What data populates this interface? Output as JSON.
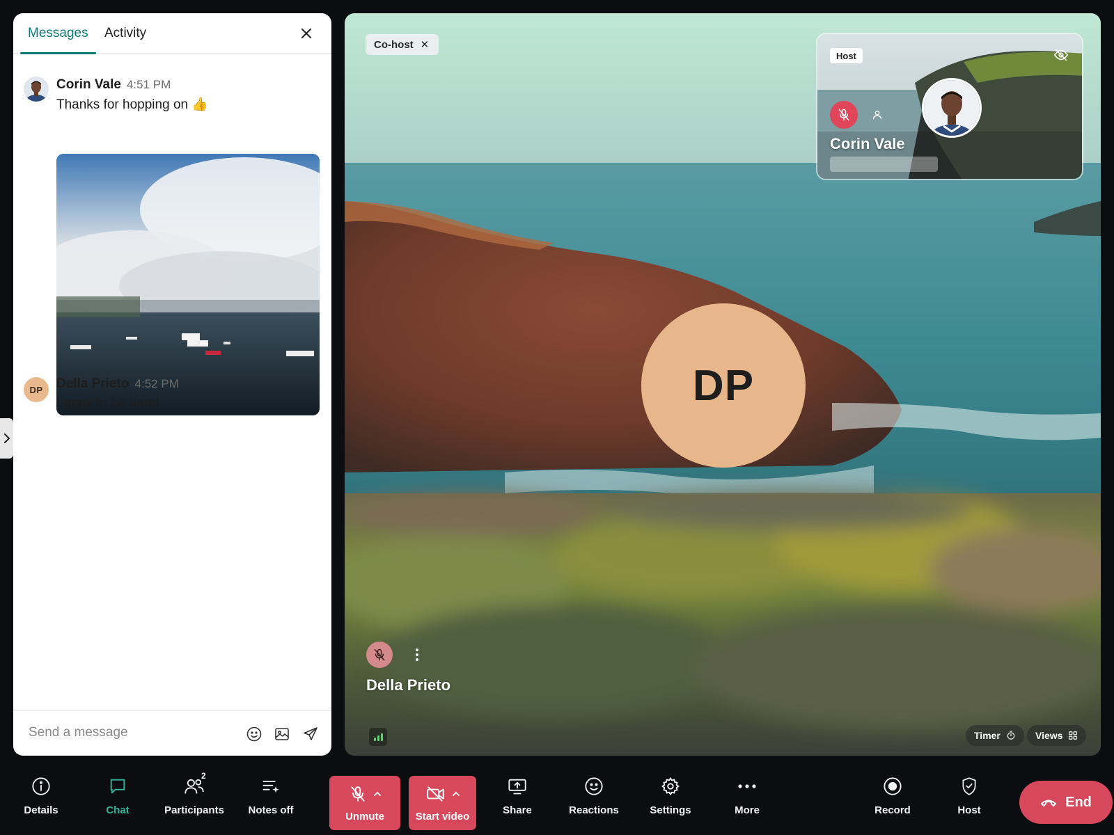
{
  "chat": {
    "tabs": [
      "Messages",
      "Activity"
    ],
    "messages": [
      {
        "name": "Corin Vale",
        "time": "4:51 PM",
        "text": "Thanks for hopping on 👍"
      },
      {
        "name": "Della Prieto",
        "initials": "DP",
        "time": "4:52 PM",
        "text": "happy to be here!"
      }
    ],
    "composer_placeholder": "Send a message"
  },
  "stage": {
    "cohost_label": "Co-host",
    "main_initials": "DP",
    "main_name": "Della Prieto",
    "timer_label": "Timer",
    "views_label": "Views",
    "host_tile": {
      "badge": "Host",
      "name": "Corin Vale"
    }
  },
  "toolbar": {
    "details": "Details",
    "chat": "Chat",
    "participants": "Participants",
    "participants_count": "2",
    "notes": "Notes off",
    "unmute": "Unmute",
    "start_video": "Start video",
    "share": "Share",
    "reactions": "Reactions",
    "settings": "Settings",
    "more": "More",
    "record": "Record",
    "host": "Host",
    "end": "End"
  },
  "colors": {
    "accent_teal": "#0f7b78",
    "chat_active": "#33b59b",
    "danger_red": "#d8485c",
    "avatar_dp": "#e8b68b"
  }
}
